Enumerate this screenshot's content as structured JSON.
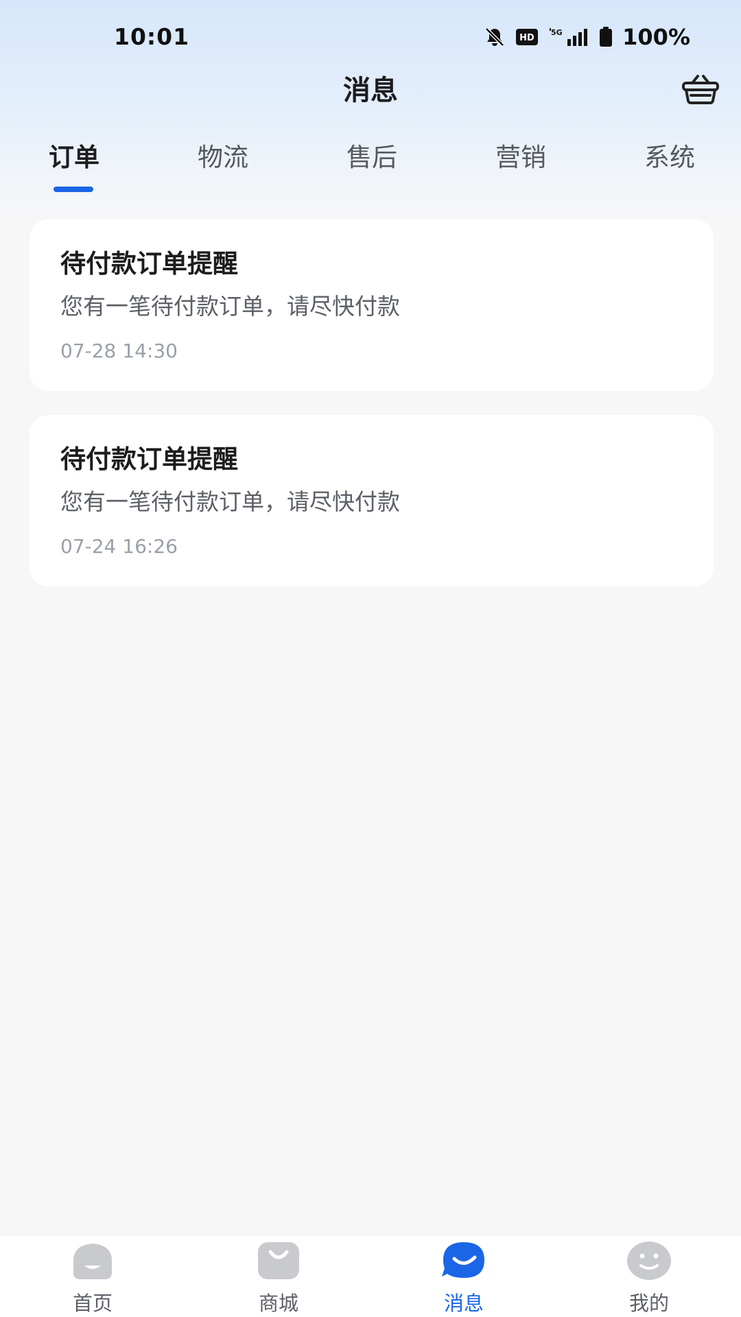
{
  "status_bar": {
    "time": "10:01",
    "network": "5G",
    "hd_label": "HD",
    "battery": "100%"
  },
  "header": {
    "title": "消息",
    "right_icon": "basket-icon"
  },
  "tabs": [
    {
      "label": "订单",
      "active": true
    },
    {
      "label": "物流",
      "active": false
    },
    {
      "label": "售后",
      "active": false
    },
    {
      "label": "营销",
      "active": false
    },
    {
      "label": "系统",
      "active": false
    }
  ],
  "messages": [
    {
      "title": "待付款订单提醒",
      "body": "您有一笔待付款订单，请尽快付款",
      "time": "07-28 14:30"
    },
    {
      "title": "待付款订单提醒",
      "body": "您有一笔待付款订单，请尽快付款",
      "time": "07-24 16:26"
    }
  ],
  "bottom_nav": [
    {
      "label": "首页",
      "icon": "home-icon",
      "active": false
    },
    {
      "label": "商城",
      "icon": "mall-icon",
      "active": false
    },
    {
      "label": "消息",
      "icon": "message-icon",
      "active": true
    },
    {
      "label": "我的",
      "icon": "profile-icon",
      "active": false
    }
  ],
  "colors": {
    "accent": "#1a66e6",
    "inactive_icon": "#c9cacd",
    "background": "#f7f7f8"
  }
}
